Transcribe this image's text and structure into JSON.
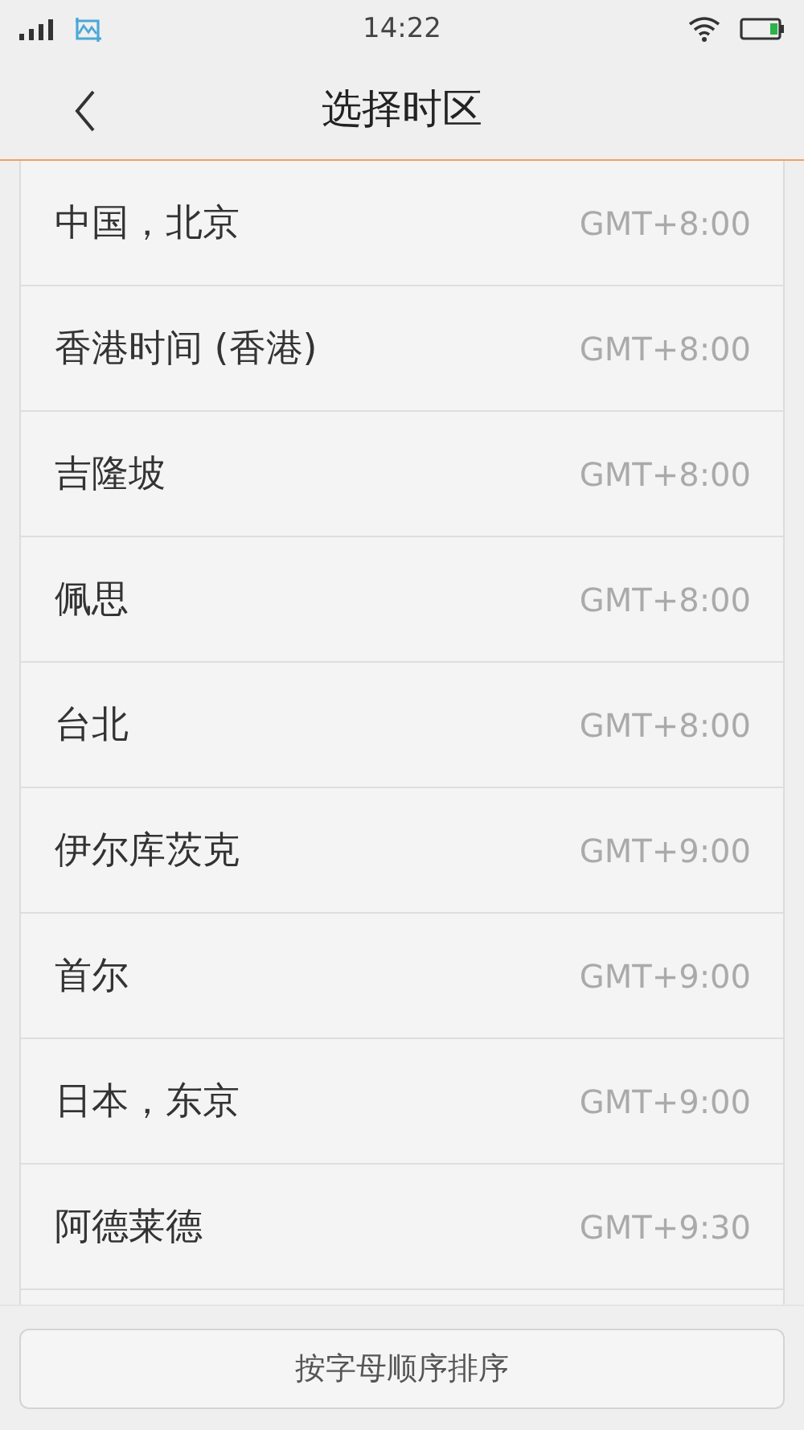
{
  "status_bar": {
    "time": "14:22"
  },
  "header": {
    "title": "选择时区"
  },
  "timezones": [
    {
      "name": "中国，北京",
      "offset": "GMT+8:00"
    },
    {
      "name": "香港时间 (香港)",
      "offset": "GMT+8:00"
    },
    {
      "name": "吉隆坡",
      "offset": "GMT+8:00"
    },
    {
      "name": "佩思",
      "offset": "GMT+8:00"
    },
    {
      "name": "台北",
      "offset": "GMT+8:00"
    },
    {
      "name": "伊尔库茨克",
      "offset": "GMT+9:00"
    },
    {
      "name": "首尔",
      "offset": "GMT+9:00"
    },
    {
      "name": "日本，东京",
      "offset": "GMT+9:00"
    },
    {
      "name": "阿德莱德",
      "offset": "GMT+9:30"
    }
  ],
  "sort_button": {
    "label": "按字母顺序排序"
  }
}
